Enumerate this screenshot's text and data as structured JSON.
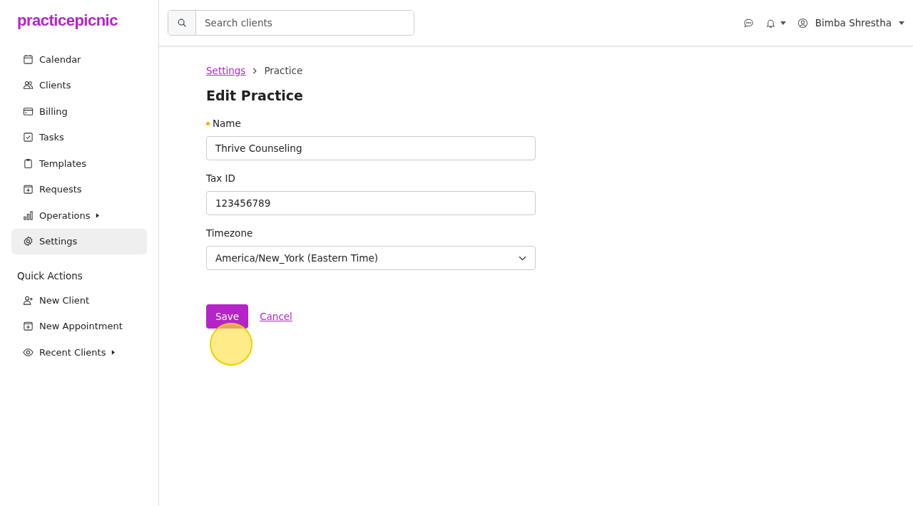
{
  "brand": "practicepicnic",
  "nav": [
    {
      "label": "Calendar",
      "selected": false,
      "submenu": false
    },
    {
      "label": "Clients",
      "selected": false,
      "submenu": false
    },
    {
      "label": "Billing",
      "selected": false,
      "submenu": false
    },
    {
      "label": "Tasks",
      "selected": false,
      "submenu": false
    },
    {
      "label": "Templates",
      "selected": false,
      "submenu": false
    },
    {
      "label": "Requests",
      "selected": false,
      "submenu": false
    },
    {
      "label": "Operations",
      "selected": false,
      "submenu": true
    },
    {
      "label": "Settings",
      "selected": true,
      "submenu": false
    }
  ],
  "quick_actions": {
    "title": "Quick Actions",
    "items": [
      {
        "label": "New Client",
        "submenu": false
      },
      {
        "label": "New Appointment",
        "submenu": false
      },
      {
        "label": "Recent Clients",
        "submenu": true
      }
    ]
  },
  "search": {
    "placeholder": "Search clients"
  },
  "user": {
    "name": "Bimba Shrestha"
  },
  "breadcrumb": [
    {
      "label": "Settings",
      "link": true
    },
    {
      "label": "Practice",
      "link": false
    }
  ],
  "page_title": "Edit Practice",
  "fields": [
    {
      "label": "Name",
      "required": true,
      "kind": "text",
      "value": "Thrive Counseling"
    },
    {
      "label": "Tax ID",
      "required": false,
      "kind": "text",
      "value": "123456789"
    },
    {
      "label": "Timezone",
      "required": false,
      "kind": "select",
      "value": "America/New_York (Eastern Time)"
    }
  ],
  "actions": {
    "save": "Save",
    "cancel": "Cancel"
  }
}
